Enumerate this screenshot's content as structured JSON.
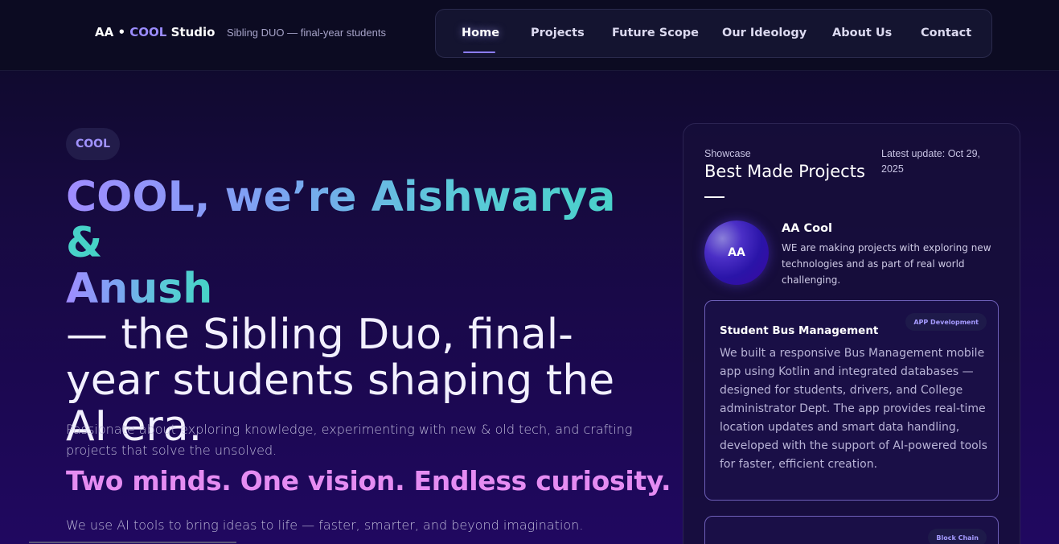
{
  "header": {
    "brand": {
      "prefix": "AA",
      "dot": "•",
      "accent": "COOL",
      "suffix": "Studio"
    },
    "subtitle": "Sibling DUO — final-year students",
    "nav": [
      {
        "label": "Home",
        "active": true
      },
      {
        "label": "Projects",
        "active": false
      },
      {
        "label": "Future Scope",
        "active": false
      },
      {
        "label": "Our Ideology",
        "active": false
      },
      {
        "label": "About Us",
        "active": false
      },
      {
        "label": "Contact",
        "active": false
      }
    ]
  },
  "hero": {
    "badge": "COOL",
    "headline_gradient_line1": "COOL, we’re Aishwarya &",
    "headline_gradient_line2": "Anush",
    "headline_plain": "— the Sibling Duo, final-year students shaping the AI era.",
    "description": "Passionate about exploring knowledge, experimenting with new & old tech, and crafting projects that solve the unsolved.",
    "tagline": "Two minds. One vision. Endless curiosity.",
    "note": "We use AI tools to bring ideas to life — faster, smarter, and beyond imagination."
  },
  "showcase": {
    "kicker": "Showcase",
    "title": "Best Made Projects",
    "latest_update": "Latest update: Oct 29, 2025",
    "author": {
      "initials": "AA",
      "name": "AA Cool",
      "description": "WE are making projects with exploring new technologies and as part of real world challenging."
    },
    "projects": [
      {
        "tag": "APP Development",
        "title": "Student Bus Management",
        "body": "We built a responsive Bus Management mobile app using Kotlin and integrated databases — designed for students, drivers, and College administrator Dept. The app provides real-time location updates and smart data handling, developed with the support of AI-powered tools for faster, efficient creation."
      },
      {
        "tag": "Block Chain"
      }
    ]
  },
  "colors": {
    "accent": "#9b8cff",
    "tagline": "#e58cf2",
    "gradient_start": "#a08cff",
    "gradient_end": "#45d3c6"
  }
}
